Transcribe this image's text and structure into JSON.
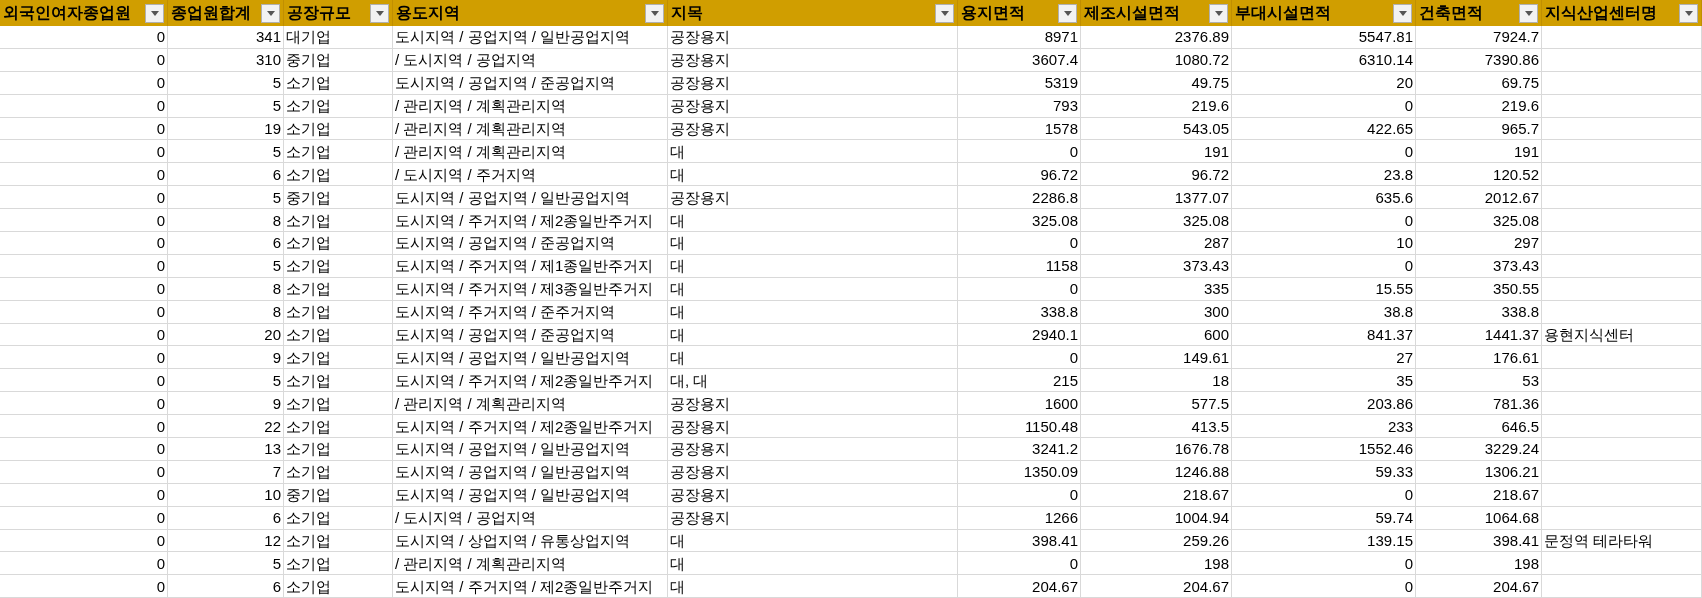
{
  "columns": [
    {
      "label": "외국인여자종업원",
      "kind": "number"
    },
    {
      "label": "종업원합계",
      "kind": "number"
    },
    {
      "label": "공장규모",
      "kind": "text"
    },
    {
      "label": "용도지역",
      "kind": "text"
    },
    {
      "label": "지목",
      "kind": "text"
    },
    {
      "label": "용지면적",
      "kind": "number"
    },
    {
      "label": "제조시설면적",
      "kind": "number"
    },
    {
      "label": "부대시설면적",
      "kind": "number"
    },
    {
      "label": "건축면적",
      "kind": "number"
    },
    {
      "label": "지식산업센터명",
      "kind": "text"
    }
  ],
  "rows": [
    [
      "0",
      "341",
      "대기업",
      "도시지역 / 공업지역 / 일반공업지역",
      "공장용지",
      "8971",
      "2376.89",
      "5547.81",
      "7924.7"
    ],
    [
      "0",
      "310",
      "중기업",
      "/ 도시지역 / 공업지역",
      "공장용지",
      "3607.4",
      "1080.72",
      "6310.14",
      "7390.86"
    ],
    [
      "0",
      "5",
      "소기업",
      "도시지역 / 공업지역 / 준공업지역",
      "공장용지",
      "5319",
      "49.75",
      "20",
      "69.75"
    ],
    [
      "0",
      "5",
      "소기업",
      "/ 관리지역 / 계획관리지역",
      "공장용지",
      "793",
      "219.6",
      "0",
      "219.6"
    ],
    [
      "0",
      "19",
      "소기업",
      "/ 관리지역 / 계획관리지역",
      "공장용지",
      "1578",
      "543.05",
      "422.65",
      "965.7"
    ],
    [
      "0",
      "5",
      "소기업",
      "/ 관리지역 / 계획관리지역",
      "대",
      "0",
      "191",
      "0",
      "191"
    ],
    [
      "0",
      "6",
      "소기업",
      "/ 도시지역 / 주거지역",
      "대",
      "96.72",
      "96.72",
      "23.8",
      "120.52"
    ],
    [
      "0",
      "5",
      "중기업",
      "도시지역 / 공업지역 / 일반공업지역",
      "공장용지",
      "2286.8",
      "1377.07",
      "635.6",
      "2012.67"
    ],
    [
      "0",
      "8",
      "소기업",
      "도시지역 / 주거지역 / 제2종일반주거지",
      "대",
      "325.08",
      "325.08",
      "0",
      "325.08"
    ],
    [
      "0",
      "6",
      "소기업",
      "도시지역 / 공업지역 / 준공업지역",
      "대",
      "0",
      "287",
      "10",
      "297"
    ],
    [
      "0",
      "5",
      "소기업",
      "도시지역 / 주거지역 / 제1종일반주거지",
      "대",
      "1158",
      "373.43",
      "0",
      "373.43"
    ],
    [
      "0",
      "8",
      "소기업",
      "도시지역 / 주거지역 / 제3종일반주거지",
      "대",
      "0",
      "335",
      "15.55",
      "350.55"
    ],
    [
      "0",
      "8",
      "소기업",
      "도시지역 / 주거지역 / 준주거지역",
      "대",
      "338.8",
      "300",
      "38.8",
      "338.8"
    ],
    [
      "0",
      "20",
      "소기업",
      "도시지역 / 공업지역 / 준공업지역",
      "대",
      "2940.1",
      "600",
      "841.37",
      "1441.37",
      "용현지식센터"
    ],
    [
      "0",
      "9",
      "소기업",
      "도시지역 / 공업지역 / 일반공업지역",
      "대",
      "0",
      "149.61",
      "27",
      "176.61"
    ],
    [
      "0",
      "5",
      "소기업",
      "도시지역 / 주거지역 / 제2종일반주거지",
      "대, 대",
      "215",
      "18",
      "35",
      "53"
    ],
    [
      "0",
      "9",
      "소기업",
      "/ 관리지역 / 계획관리지역",
      "공장용지",
      "1600",
      "577.5",
      "203.86",
      "781.36"
    ],
    [
      "0",
      "22",
      "소기업",
      "도시지역 / 주거지역 / 제2종일반주거지",
      "공장용지",
      "1150.48",
      "413.5",
      "233",
      "646.5"
    ],
    [
      "0",
      "13",
      "소기업",
      "도시지역 / 공업지역 / 일반공업지역",
      "공장용지",
      "3241.2",
      "1676.78",
      "1552.46",
      "3229.24"
    ],
    [
      "0",
      "7",
      "소기업",
      "도시지역 / 공업지역 / 일반공업지역",
      "공장용지",
      "1350.09",
      "1246.88",
      "59.33",
      "1306.21"
    ],
    [
      "0",
      "10",
      "중기업",
      "도시지역 / 공업지역 / 일반공업지역",
      "공장용지",
      "0",
      "218.67",
      "0",
      "218.67"
    ],
    [
      "0",
      "6",
      "소기업",
      "/ 도시지역 / 공업지역",
      "공장용지",
      "1266",
      "1004.94",
      "59.74",
      "1064.68"
    ],
    [
      "0",
      "12",
      "소기업",
      "도시지역 / 상업지역 / 유통상업지역",
      "대",
      "398.41",
      "259.26",
      "139.15",
      "398.41",
      "문정역 테라타워"
    ],
    [
      "0",
      "5",
      "소기업",
      "/ 관리지역 / 계획관리지역",
      "대",
      "0",
      "198",
      "0",
      "198"
    ],
    [
      "0",
      "6",
      "소기업",
      "도시지역 / 주거지역 / 제2종일반주거지",
      "대",
      "204.67",
      "204.67",
      "0",
      "204.67"
    ]
  ]
}
